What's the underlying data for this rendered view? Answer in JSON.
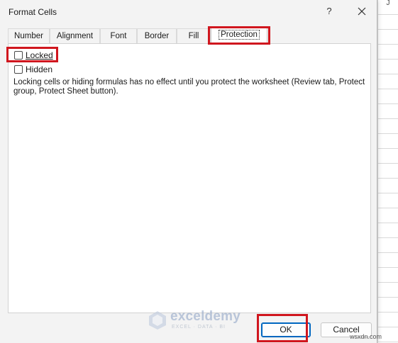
{
  "window": {
    "title": "Format Cells",
    "help_label": "?",
    "close_icon": "close-icon"
  },
  "background": {
    "column_header": "J"
  },
  "tabs": [
    {
      "label": "Number",
      "active": false
    },
    {
      "label": "Alignment",
      "active": false
    },
    {
      "label": "Font",
      "active": false
    },
    {
      "label": "Border",
      "active": false
    },
    {
      "label": "Fill",
      "active": false
    },
    {
      "label": "Protection",
      "active": true
    }
  ],
  "protection": {
    "locked": {
      "label": "Locked",
      "checked": false
    },
    "hidden": {
      "label": "Hidden",
      "checked": false
    },
    "description": "Locking cells or hiding formulas has no effect until you protect the worksheet (Review tab, Protect group, Protect Sheet button)."
  },
  "buttons": {
    "ok": "OK",
    "cancel": "Cancel"
  },
  "watermark": {
    "name": "exceldemy",
    "tagline": "EXCEL · DATA · BI",
    "site": "wsxdn.com"
  },
  "colors": {
    "highlight": "#d0161e",
    "accent": "#0067c0"
  }
}
